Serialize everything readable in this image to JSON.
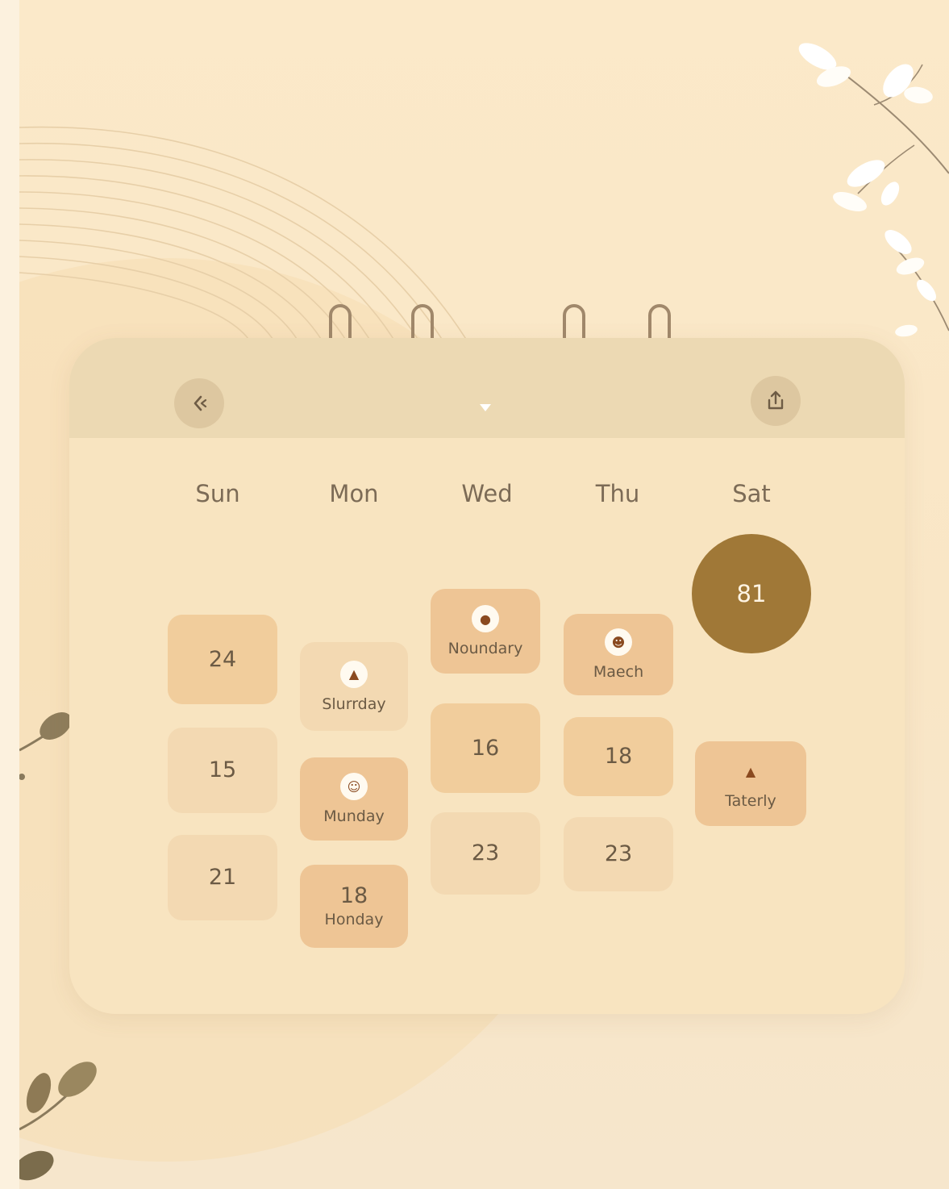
{
  "header": {
    "back_icon": "double-chevron-left-icon",
    "dropdown_icon": "caret-down-icon",
    "share_icon": "share-icon"
  },
  "weekdays": [
    "Sun",
    "Mon",
    "Wed",
    "Thu",
    "Sat"
  ],
  "days": {
    "sun_1": {
      "num": "24"
    },
    "sun_2": {
      "num": "15"
    },
    "sun_3": {
      "num": "21"
    },
    "mon_1": {
      "label": "Slurrday",
      "icon": "mushroom-icon"
    },
    "mon_2": {
      "label": "Munday",
      "icon": "face-icon"
    },
    "mon_3": {
      "num": "18",
      "label": "Honday"
    },
    "wed_1": {
      "label": "Noundary",
      "icon": "cow-icon"
    },
    "wed_2": {
      "num": "16"
    },
    "wed_3": {
      "num": "23"
    },
    "thu_1": {
      "label": "Maech",
      "icon": "smiley-icon"
    },
    "thu_2": {
      "num": "18"
    },
    "thu_3": {
      "num": "23"
    },
    "sat_1": {
      "num": "81"
    },
    "sat_2": {
      "label": "Taterly",
      "icon": "mushroom-icon"
    }
  },
  "colors": {
    "background": "#fbe9c9",
    "calendar": "#f8e4c0",
    "header": "#ecd9b3",
    "accent": "#a07837"
  }
}
